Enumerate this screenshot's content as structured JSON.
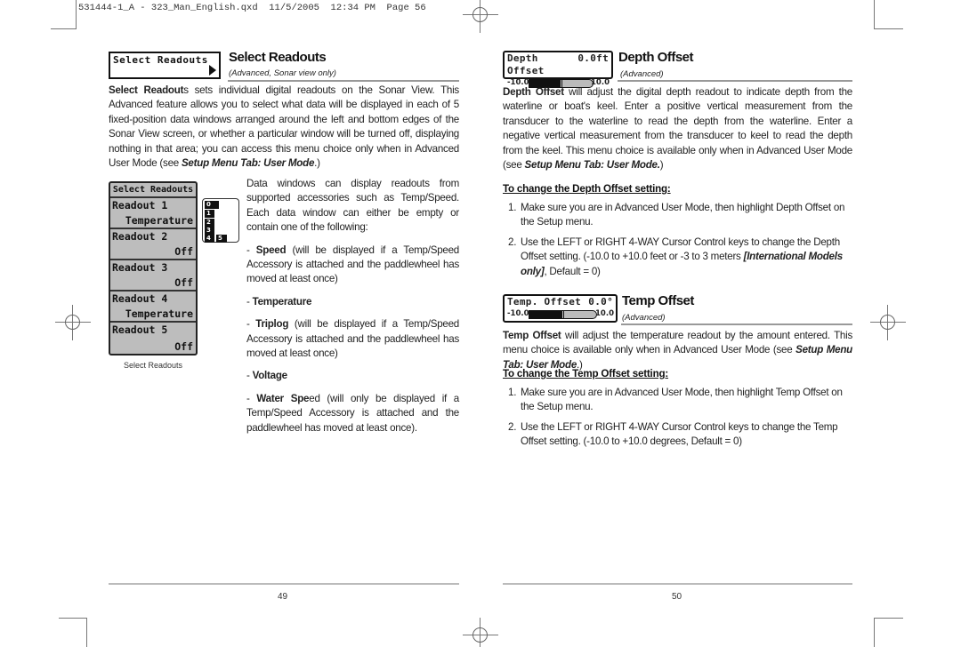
{
  "slug": "531444-1_A - 323_Man_English.qxd  11/5/2005  12:34 PM  Page 56",
  "left_page": {
    "menu_box": {
      "label": "Select Readouts",
      "icon": "right-arrow-icon"
    },
    "title": "Select Readouts",
    "subtitle": "(Advanced, Sonar view only)",
    "intro_bold": "Select Readout",
    "intro_rest": "s sets individual digital readouts on the Sonar View. This Advanced feature allows you to select what data will be displayed in each of 5 fixed-position data windows arranged around the left and bottom edges of the Sonar View screen, or whether a particular window will be turned off, displaying nothing in that area; you can access this menu choice only when in Advanced User Mode (see ",
    "intro_ref": "Setup Menu Tab: User Mode",
    "intro_end": ".)",
    "readouts_menu": {
      "header": "Select Readouts",
      "items": [
        {
          "label": "Readout 1",
          "value": "Temperature"
        },
        {
          "label": "Readout 2",
          "value": "Off"
        },
        {
          "label": "Readout 3",
          "value": "Off"
        },
        {
          "label": "Readout 4",
          "value": "Temperature"
        },
        {
          "label": "Readout 5",
          "value": "Off"
        }
      ],
      "caption": "Select Readouts"
    },
    "window_diagram": {
      "labels": [
        "0",
        "1",
        "2",
        "3",
        "4",
        "5"
      ]
    },
    "data_windows_text": "Data windows can display readouts from supported accessories such as Temp/Speed. Each data window can either be empty or contain one of the following:",
    "options": [
      {
        "bold": "Speed",
        "text": " (will be displayed if a Temp/Speed Accessory is attached and the paddlewheel has moved at least once)"
      },
      {
        "bold": "Temperature",
        "text": ""
      },
      {
        "bold": "Triplog",
        "text": " (will be displayed if a Temp/Speed Accessory is attached and the paddlewheel has moved at least once)"
      },
      {
        "bold": "Voltage",
        "text": ""
      },
      {
        "bold": "Water Spe",
        "text": "ed (will only be displayed if a Temp/Speed Accessory is attached and the paddlewheel has moved at least once)."
      }
    ],
    "page_number": "49"
  },
  "right_page": {
    "depth": {
      "box_label": "Depth Offset",
      "box_value": "0.0ft",
      "min": "-10.0",
      "max": "10.0",
      "slider_fraction": 0.5,
      "title": "Depth Offset",
      "subtitle": "(Advanced)",
      "body_bold": "Depth Offset",
      "body_rest": " will adjust the digital depth readout to indicate depth from the waterline or boat's keel. Enter a positive vertical measurement from the transducer to the waterline to read the depth from the waterline. Enter a negative vertical measurement from the transducer to keel to read the depth from the keel. This menu choice is available only when in Advanced User Mode (see ",
      "body_ref": "Setup Menu Tab: User Mode.",
      "body_end": ")",
      "howto_heading": "To change the Depth Offset setting:",
      "steps": [
        {
          "num": "1.",
          "text": "Make sure you are in Advanced User Mode, then highlight Depth Offset on the Setup menu."
        },
        {
          "num": "2.",
          "text": "Use the LEFT or RIGHT 4-WAY Cursor Control keys to change the Depth Offset setting. (-10.0 to +10.0 feet or -3 to 3 meters ",
          "italic": "[International Models only]",
          "tail": ", Default = 0)"
        }
      ]
    },
    "temp": {
      "box_label": "Temp. Offset",
      "box_value": "0.0°",
      "min": "-10.0",
      "max": "10.0",
      "slider_fraction": 0.5,
      "title": "Temp Offset",
      "subtitle": "(Advanced)",
      "body_bold": "Temp Offset",
      "body_rest": " will adjust the temperature readout by the amount entered. This menu choice is available only when in Advanced User Mode  (see ",
      "body_ref": "Setup Menu Tab: User Mode",
      "body_end": ".)",
      "howto_heading": "To change the Temp Offset setting:",
      "steps": [
        {
          "num": "1.",
          "text": "Make sure you are in Advanced User Mode, then highlight Temp Offset on the Setup menu."
        },
        {
          "num": "2.",
          "text": "Use the LEFT or RIGHT 4-WAY Cursor Control keys to change the Temp Offset setting. (-10.0 to +10.0 degrees, Default = 0)"
        }
      ]
    },
    "page_number": "50"
  }
}
